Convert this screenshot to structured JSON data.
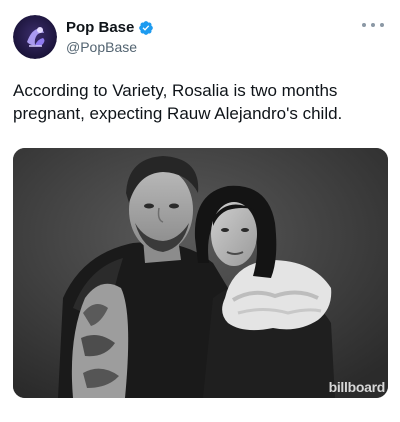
{
  "author": {
    "display_name": "Pop Base",
    "handle": "@PopBase",
    "verified": true,
    "avatar_icon": "pop-base-logo-icon",
    "verified_icon": "verified-badge-icon"
  },
  "more_icon": "more-options-icon",
  "tweet": {
    "text": "According to Variety, Rosalia is two months pregnant, expecting Rauw Alejandro's child."
  },
  "media": {
    "watermark": "billboard",
    "style": "black-and-white photo"
  },
  "colors": {
    "verified_blue": "#1d9bf0",
    "avatar_bg": "#2a1f4a",
    "text_primary": "#0f1419",
    "text_secondary": "#536471"
  }
}
